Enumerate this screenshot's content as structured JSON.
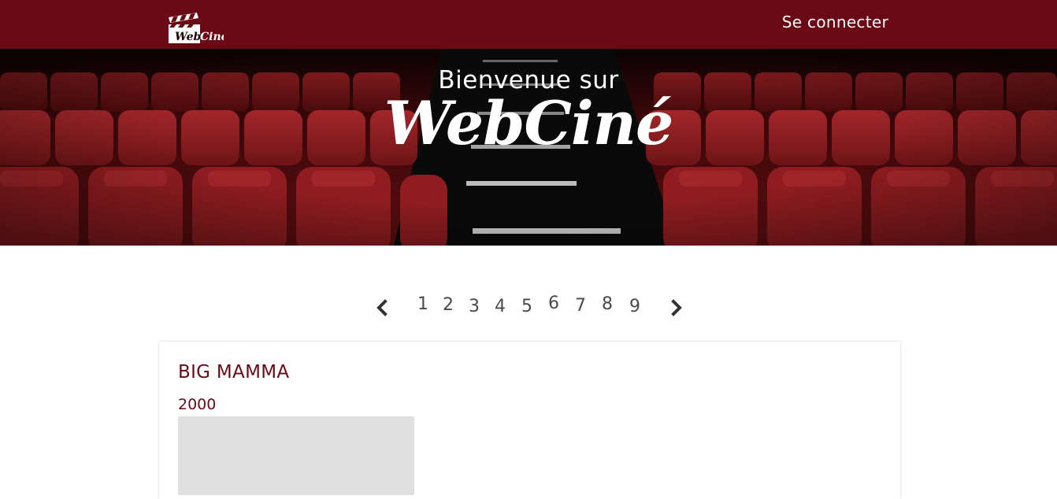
{
  "brand": {
    "logo_text": "WebCiné",
    "primary_color": "#6b0914"
  },
  "navbar": {
    "login_label": "Se connecter"
  },
  "hero": {
    "welcome": "Bienvenue sur",
    "brand_name": "WebCiné"
  },
  "pagination": {
    "prev_icon": "chevron-left-icon",
    "next_icon": "chevron-right-icon",
    "pages": [
      "1",
      "2",
      "3",
      "4",
      "5",
      "6",
      "7",
      "8",
      "9"
    ]
  },
  "film": {
    "title": "BIG MAMMA",
    "year": "2000"
  }
}
